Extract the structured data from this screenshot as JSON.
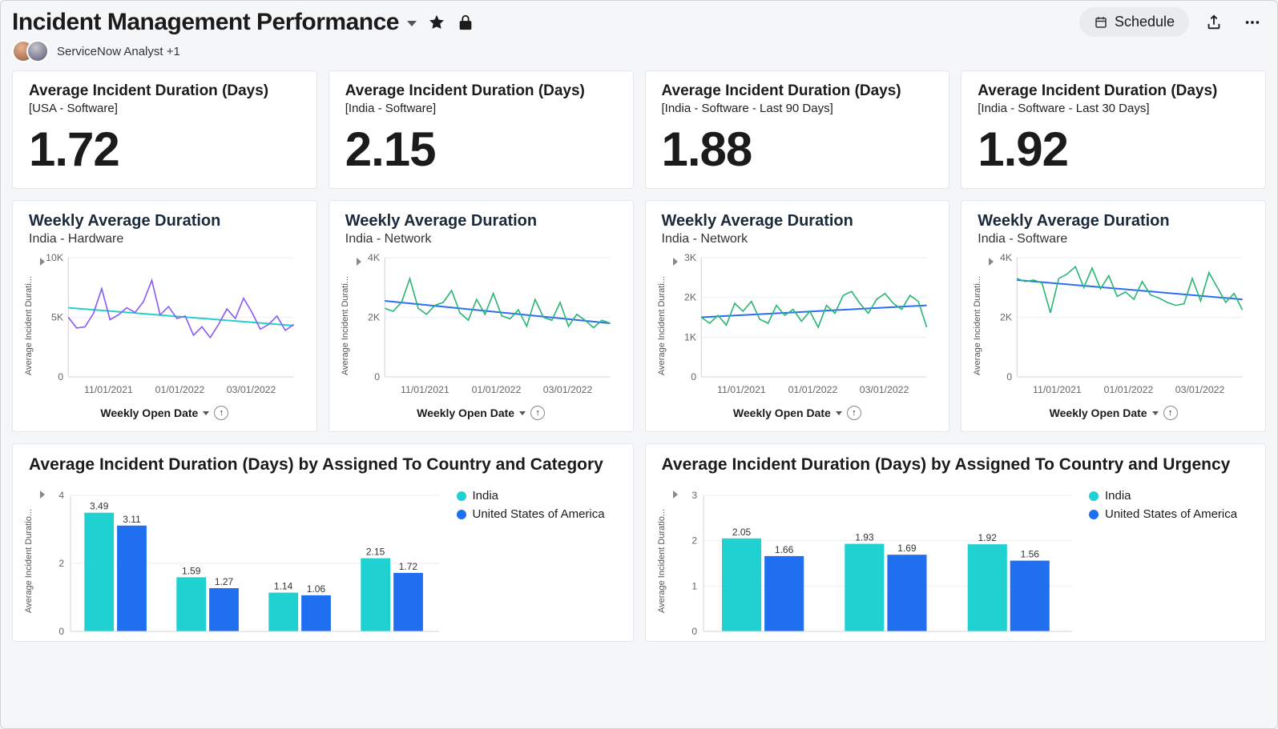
{
  "header": {
    "title": "Incident Management Performance",
    "schedule_label": "Schedule",
    "analyst_label": "ServiceNow Analyst +1"
  },
  "kpis": [
    {
      "title": "Average Incident Duration (Days)",
      "subtitle": "[USA - Software]",
      "value": "1.72"
    },
    {
      "title": "Average Incident Duration (Days)",
      "subtitle": "[India - Software]",
      "value": "2.15"
    },
    {
      "title": "Average Incident Duration (Days)",
      "subtitle": "[India - Software - Last 90 Days]",
      "value": "1.88"
    },
    {
      "title": "Average Incident Duration (Days)",
      "subtitle": "[India - Software - Last 30 Days]",
      "value": "1.92"
    }
  ],
  "mini_common": {
    "y_axis_label": "Average Incident Durati...",
    "footer_label": "Weekly Open Date",
    "x_ticks": [
      "11/01/2021",
      "01/01/2022",
      "03/01/2022"
    ]
  },
  "colors": {
    "purple": "#8a5cf6",
    "teal": "#26d0ce",
    "green": "#2bb673",
    "blue": "#2b6cf6",
    "cyan_bar": "#1fd1d1",
    "blue_bar": "#1f6ff0"
  },
  "chart_data": [
    {
      "type": "line",
      "title": "Weekly Average Duration",
      "subtitle": "India - Hardware",
      "ylabel": "Average Incident Duration",
      "xlabel": "Weekly Open Date",
      "ylim": [
        0,
        10000
      ],
      "y_ticks": [
        "0",
        "5K",
        "10K"
      ],
      "line_color": "purple",
      "trend_color": "teal",
      "x": [
        0,
        1,
        2,
        3,
        4,
        5,
        6,
        7,
        8,
        9,
        10,
        11,
        12,
        13,
        14,
        15,
        16,
        17,
        18,
        19,
        20,
        21,
        22,
        23,
        24,
        25,
        26,
        27
      ],
      "values": [
        5000,
        4100,
        4200,
        5300,
        7400,
        4800,
        5200,
        5800,
        5400,
        6300,
        8100,
        5200,
        5900,
        4900,
        5100,
        3500,
        4200,
        3300,
        4400,
        5700,
        4900,
        6600,
        5400,
        4000,
        4400,
        5100,
        3900,
        4400
      ],
      "trend": [
        5800,
        4300
      ]
    },
    {
      "type": "line",
      "title": "Weekly Average Duration",
      "subtitle": "India - Network",
      "ylabel": "Average Incident Duration",
      "xlabel": "Weekly Open Date",
      "ylim": [
        0,
        4000
      ],
      "y_ticks": [
        "0",
        "2K",
        "4K"
      ],
      "line_color": "green",
      "trend_color": "blue",
      "x": [
        0,
        1,
        2,
        3,
        4,
        5,
        6,
        7,
        8,
        9,
        10,
        11,
        12,
        13,
        14,
        15,
        16,
        17,
        18,
        19,
        20,
        21,
        22,
        23,
        24,
        25,
        26,
        27
      ],
      "values": [
        2300,
        2200,
        2500,
        3300,
        2300,
        2100,
        2400,
        2500,
        2900,
        2150,
        1900,
        2600,
        2100,
        2800,
        2050,
        1950,
        2250,
        1700,
        2600,
        2000,
        1900,
        2500,
        1700,
        2100,
        1900,
        1650,
        1900,
        1800
      ],
      "trend": [
        2550,
        1800
      ]
    },
    {
      "type": "line",
      "title": "Weekly Average Duration",
      "subtitle": "India - Network",
      "ylabel": "Average Incident Duration",
      "xlabel": "Weekly Open Date",
      "ylim": [
        0,
        3000
      ],
      "y_ticks": [
        "0",
        "1K",
        "2K",
        "3K"
      ],
      "line_color": "green",
      "trend_color": "blue",
      "x": [
        0,
        1,
        2,
        3,
        4,
        5,
        6,
        7,
        8,
        9,
        10,
        11,
        12,
        13,
        14,
        15,
        16,
        17,
        18,
        19,
        20,
        21,
        22,
        23,
        24,
        25,
        26,
        27
      ],
      "values": [
        1500,
        1350,
        1550,
        1300,
        1850,
        1650,
        1900,
        1450,
        1350,
        1800,
        1550,
        1700,
        1400,
        1650,
        1250,
        1800,
        1600,
        2050,
        2150,
        1850,
        1600,
        1950,
        2100,
        1850,
        1700,
        2050,
        1900,
        1250
      ],
      "trend": [
        1500,
        1800
      ]
    },
    {
      "type": "line",
      "title": "Weekly Average Duration",
      "subtitle": "India - Software",
      "ylabel": "Average Incident Duration",
      "xlabel": "Weekly Open Date",
      "ylim": [
        0,
        4000
      ],
      "y_ticks": [
        "0",
        "2K",
        "4K"
      ],
      "line_color": "green",
      "trend_color": "blue",
      "x": [
        0,
        1,
        2,
        3,
        4,
        5,
        6,
        7,
        8,
        9,
        10,
        11,
        12,
        13,
        14,
        15,
        16,
        17,
        18,
        19,
        20,
        21,
        22,
        23,
        24,
        25,
        26,
        27
      ],
      "values": [
        3300,
        3200,
        3250,
        3150,
        2150,
        3300,
        3450,
        3700,
        3000,
        3650,
        2950,
        3400,
        2700,
        2850,
        2600,
        3200,
        2750,
        2650,
        2500,
        2400,
        2450,
        3300,
        2550,
        3500,
        3000,
        2500,
        2800,
        2250
      ],
      "trend": [
        3250,
        2600
      ]
    },
    {
      "type": "bar",
      "title": "Average Incident Duration (Days) by Assigned To Country and Category",
      "ylabel": "Average Incident Duratio...",
      "ylim": [
        0,
        4
      ],
      "y_ticks": [
        "0",
        "2",
        "4"
      ],
      "categories": [
        "",
        "",
        "",
        ""
      ],
      "series": [
        {
          "name": "India",
          "color": "cyan_bar",
          "values": [
            3.49,
            1.59,
            1.14,
            2.15
          ]
        },
        {
          "name": "United States of America",
          "color": "blue_bar",
          "values": [
            3.11,
            1.27,
            1.06,
            1.72
          ]
        }
      ]
    },
    {
      "type": "bar",
      "title": "Average Incident Duration (Days) by Assigned To Country and Urgency",
      "ylabel": "Average Incident Duratio...",
      "ylim": [
        0,
        3
      ],
      "y_ticks": [
        "0",
        "1",
        "2",
        "3"
      ],
      "categories": [
        "",
        "",
        ""
      ],
      "series": [
        {
          "name": "India",
          "color": "cyan_bar",
          "values": [
            2.05,
            1.93,
            1.92
          ]
        },
        {
          "name": "United States of America",
          "color": "blue_bar",
          "values": [
            1.66,
            1.69,
            1.56
          ]
        }
      ]
    }
  ]
}
